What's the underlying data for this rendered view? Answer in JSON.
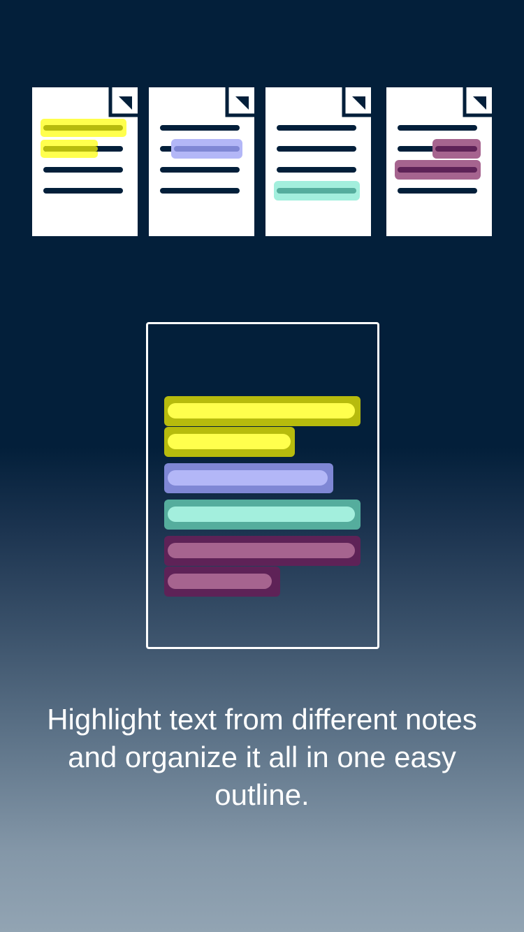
{
  "colors": {
    "background_top": "#031f3a",
    "background_bottom": "#92a4b3",
    "document": "#ffffff",
    "text_line": "#031f3a",
    "yellow_highlight": "#ffff4d",
    "yellow_dark": "#b7bb0d",
    "blue_highlight": "#b3b7f7",
    "blue_dark": "#7f87d5",
    "teal_highlight": "#a3efdd",
    "teal_dark": "#55ad9d",
    "purple_highlight": "#a6648f",
    "purple_dark": "#5e2257"
  },
  "icons": {
    "documents": [
      "document-icon",
      "document-icon",
      "document-icon",
      "document-icon"
    ],
    "outline": "outline-document-icon"
  },
  "caption": "Highlight text from different notes and organize it all in one easy outline."
}
